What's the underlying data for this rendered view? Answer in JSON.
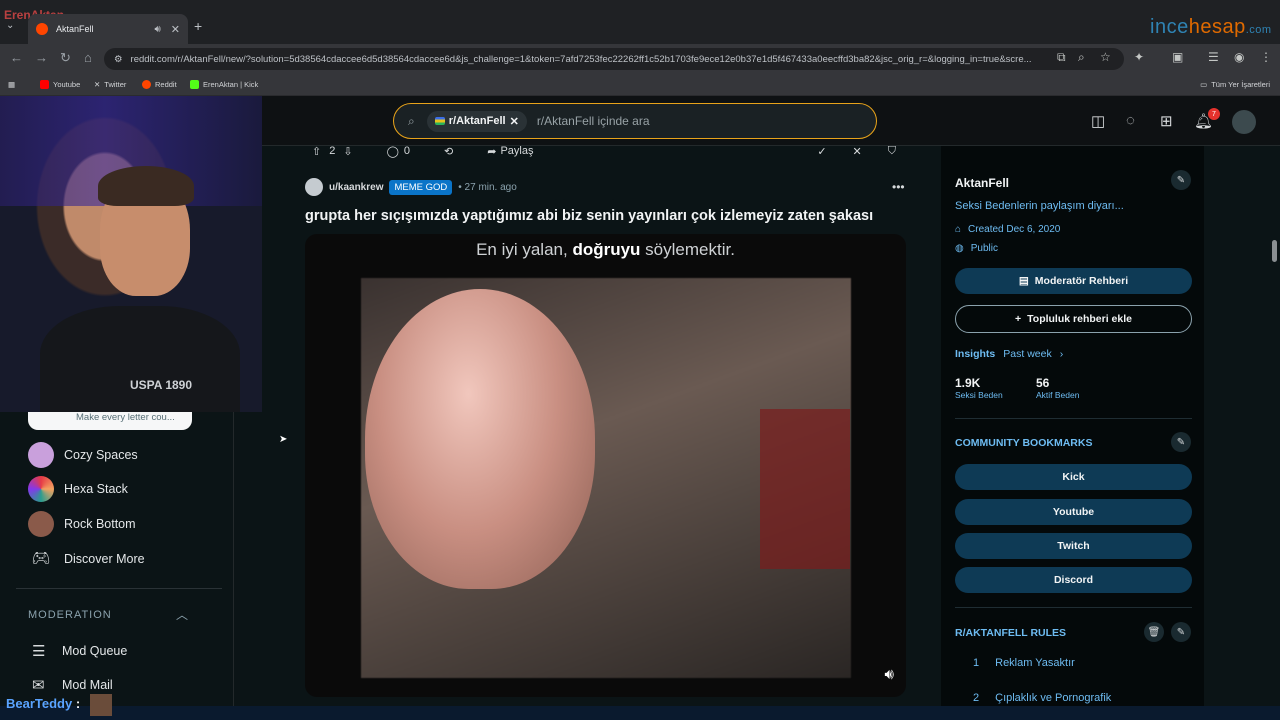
{
  "browser": {
    "tab_title": "AktanFell",
    "url": "reddit.com/r/AktanFell/new/?solution=5d38564cdaccee6d5d38564cdaccee6d&js_challenge=1&token=7afd7253fec22262ff1c52b1703fe9ece12e0b37e1d5f467433a0eecffd3ba82&jsc_orig_r=&logging_in=true&scre...",
    "bookmarks": [
      "Youtube",
      "Twitter",
      "Reddit",
      "ErenAktan | Kick"
    ],
    "all_bookmarks": "Tüm Yer İşaretleri",
    "watermark_a": "ince",
    "watermark_b": "hesap",
    "watermark_c": ".com",
    "channel_logo": "ErenAktan"
  },
  "header": {
    "search_chip": "r/AktanFell",
    "search_placeholder": "r/AktanFell içinde ara",
    "notification_count": "7"
  },
  "sidebar": {
    "input_hint": "Make every letter cou...",
    "items": [
      {
        "label": "Cozy Spaces",
        "color": "#c9a0dc"
      },
      {
        "label": "Hexa Stack",
        "color": "#f0a030"
      },
      {
        "label": "Rock Bottom",
        "color": "#8a5a4a"
      },
      {
        "label": "Discover More",
        "color": ""
      }
    ],
    "moderation_heading": "MODERATION",
    "mod_items": [
      "Mod Queue",
      "Mod Mail"
    ]
  },
  "post": {
    "votes": "2",
    "comments": "0",
    "share": "Paylaş",
    "author": "u/kaankrew",
    "flair": "MEME GOD",
    "time": "27 min. ago",
    "title": "grupta her sıçışımızda yaptığımız abi biz senin yayınları çok izlemeyiz zaten şakası",
    "caption_prefix": "En iyi yalan, ",
    "caption_bold": "doğruyu",
    "caption_suffix": " söylemektir."
  },
  "community": {
    "name": "AktanFell",
    "description": "Seksi Bedenlerin paylaşım diyarı...",
    "created": "Created Dec 6, 2020",
    "visibility": "Public",
    "mod_guide": "Moderatör Rehberi",
    "add_guide": "Topluluk rehberi ekle",
    "insights_label": "Insights",
    "insights_period": "Past week",
    "stats": [
      {
        "value": "1.9K",
        "label": "Seksi Beden"
      },
      {
        "value": "56",
        "label": "Aktif Beden"
      }
    ],
    "bookmarks_heading": "COMMUNITY BOOKMARKS",
    "bookmarks": [
      "Kick",
      "Youtube",
      "Twitch",
      "Discord"
    ],
    "rules_heading": "R/AKTANFELL RULES",
    "rules": [
      {
        "num": "1",
        "text": "Reklam Yasaktır"
      },
      {
        "num": "2",
        "text": "Çıplaklık ve Pornografik"
      }
    ]
  },
  "overlay": {
    "chat_user": "BearTeddy",
    "chat_colon": ":",
    "webcam_shirt": "USPA 1890"
  }
}
